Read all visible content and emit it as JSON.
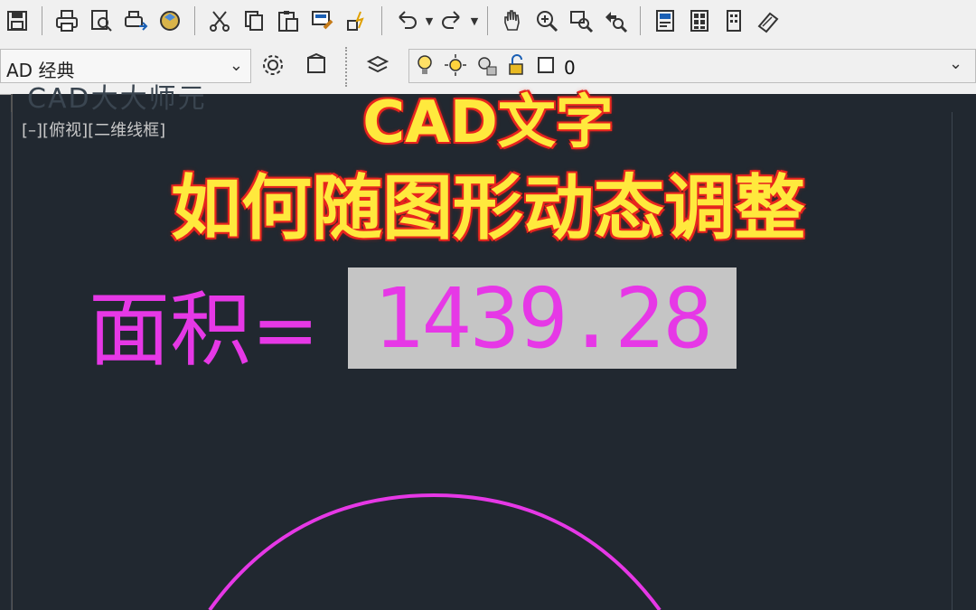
{
  "toolbar": {
    "icons": [
      "save-icon",
      "print-icon",
      "print-preview-icon",
      "plot-icon",
      "publish-3d-icon",
      "cut-icon",
      "copy-icon",
      "paste-icon",
      "match-properties-icon",
      "block-editor-icon",
      "undo-icon",
      "redo-icon",
      "pan-icon",
      "zoom-realtime-icon",
      "zoom-window-icon",
      "zoom-previous-icon",
      "properties-icon",
      "design-center-icon",
      "tool-palettes-icon",
      "sheet-set-icon"
    ]
  },
  "workspace": {
    "label": "AD 经典"
  },
  "layer": {
    "name": "0"
  },
  "viewport": {
    "label": "[–][俯视][二维线框]"
  },
  "watermark": "CAD大大师元",
  "title": {
    "line1": "CAD文字",
    "line2": "如何随图形动态调整"
  },
  "drawing": {
    "area_label": "面积=",
    "area_value": "1439.28",
    "colors": {
      "magenta": "#e638e6",
      "field_bg": "#c5c5c5",
      "canvas": "#212830"
    }
  }
}
